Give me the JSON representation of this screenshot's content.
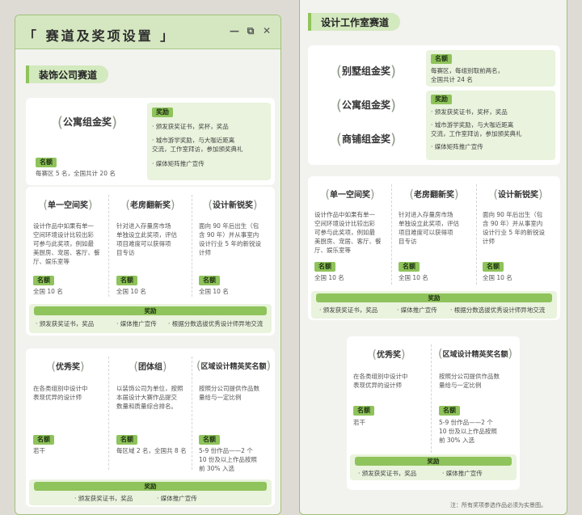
{
  "left": {
    "title": "「 赛道及奖项设置 」",
    "controls": {
      "minimize": "—",
      "restore": "⧉",
      "close": "✕"
    },
    "section": "装饰公司赛道",
    "apartment": {
      "award": "公寓组金奖",
      "quota_label": "名额",
      "quota_text": "每赛区 5 名，全国共计 20 名",
      "reward_label": "奖励",
      "rewards": [
        "· 颁发获奖证书，奖杯，奖品",
        "· 城市游学奖励，与大咖近距离",
        "  交流，工作室拜访，参加颁奖典礼",
        "· 媒体矩阵推广宣传"
      ]
    },
    "row1": {
      "cols": [
        {
          "title": "单一空间奖",
          "desc": [
            "设计作品中如果有单一",
            "空间环境设计比较出彩",
            "可参与此奖项，例如最",
            "美厨房、宠居、客厅、餐",
            "厅、娱乐室等"
          ],
          "quota_label": "名额",
          "quota": "全国 10 名"
        },
        {
          "title": "老房翻新奖",
          "desc": [
            "针对进入存量房市场",
            "单独设立此奖项，评估",
            "项目难度可以获得项",
            "目专访"
          ],
          "quota_label": "名额",
          "quota": "全国 10 名"
        },
        {
          "title": "设计新锐奖",
          "desc": [
            "面向 90 年后出生（包",
            "含 90 年）并从事室内",
            "设计行业 5 年的新锐设",
            "计师"
          ],
          "quota_label": "名额",
          "quota": "全国 10 名"
        }
      ],
      "reward_label": "奖励",
      "rewards": [
        "· 颁发获奖证书，奖品",
        "· 媒体推广宣传",
        "· 根据分数选拔优秀设计师异地交流"
      ]
    },
    "row2": {
      "cols": [
        {
          "title": "优秀奖",
          "desc": [
            "在各类组别中设计中",
            "表现优异的设计师"
          ],
          "quota_label": "名额",
          "quota": "若干"
        },
        {
          "title": "团体组",
          "desc": [
            "以装饰公司为单位，按照",
            "本届设计大赛作品提交",
            "数量和质量综合排名。"
          ],
          "quota_label": "名额",
          "quota": "每区域 2 名，全国共 8 名"
        },
        {
          "title": "区域设计精英奖名额",
          "desc": [
            "按照分公司提供作品数",
            "量给与一定比例"
          ],
          "quota_label": "名额",
          "quota_lines": [
            "5-9 份作品——2 个",
            "10 份及以上作品按照",
            "前 30% 入选"
          ]
        }
      ],
      "reward_label": "奖励",
      "rewards": [
        "· 颁发获奖证书，奖品",
        "· 媒体推广宣传"
      ]
    }
  },
  "right": {
    "section": "设计工作室赛道",
    "awards": [
      "别墅组金奖",
      "公寓组金奖",
      "商铺组金奖"
    ],
    "quota_label": "名额",
    "quota_lines": [
      "每赛区，每组别取前两名，",
      "全国共计 24 名"
    ],
    "reward_label": "奖励",
    "rewards": [
      "· 颁发获奖证书，奖杯，奖品",
      "· 城市游学奖励，与大咖近距离",
      "  交流，工作室拜访，参加颁奖典礼",
      "· 媒体矩阵推广宣传"
    ],
    "row1": {
      "cols": [
        {
          "title": "单一空间奖",
          "desc": [
            "设计作品中如果有单一",
            "空间环境设计比较出彩",
            "可参与此奖项，例如最",
            "美厨房、宠居、客厅、餐",
            "厅、娱乐室等"
          ],
          "quota_label": "名额",
          "quota": "全国 10 名"
        },
        {
          "title": "老房翻新奖",
          "desc": [
            "针对进入存量房市场",
            "单独设立此奖项，评估",
            "项目难度可以获得项",
            "目专访"
          ],
          "quota_label": "名额",
          "quota": "全国 10 名"
        },
        {
          "title": "设计新锐奖",
          "desc": [
            "面向 90 年后出生（包",
            "含 90 年）并从事室内",
            "设计行业 5 年的新锐设",
            "计师"
          ],
          "quota_label": "名额",
          "quota": "全国 10 名"
        }
      ],
      "reward_label": "奖励",
      "rewards": [
        "· 颁发获奖证书，奖品",
        "· 媒体推广宣传",
        "· 根据分数选拔优秀设计师异地交流"
      ]
    },
    "row2": {
      "cols": [
        {
          "title": "优秀奖",
          "desc": [
            "在各类组别中设计中",
            "表现优异的设计师"
          ],
          "quota_label": "名额",
          "quota": "若干"
        },
        {
          "title": "区域设计精英奖名额",
          "desc": [
            "按照分公司提供作品数",
            "量给与一定比例"
          ],
          "quota_label": "名额",
          "quota_lines": [
            "5-9 份作品——2 个",
            "10 份及以上作品按照",
            "前 30% 入选"
          ]
        }
      ],
      "reward_label": "奖励",
      "rewards": [
        "· 颁发获奖证书，奖品",
        "· 媒体推广宣传"
      ]
    },
    "note": "注：所有奖项参选作品必须为实景图。"
  },
  "colors": {
    "accent": "#8fc35b",
    "title_bg": "#d4e7c0",
    "section_bg": "#d3e9be",
    "panel_bg": "#f2f2ee",
    "page_bg": "#dedbd4"
  }
}
